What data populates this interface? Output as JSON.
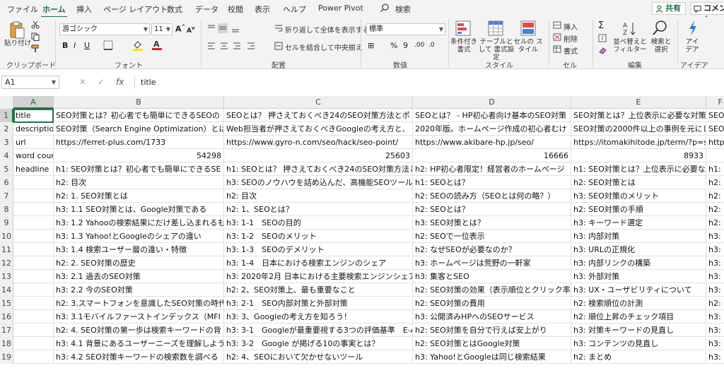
{
  "menu": {
    "tabs": [
      "ファイル",
      "ホーム",
      "挿入",
      "ページ レイアウト",
      "数式",
      "データ",
      "校閲",
      "表示",
      "ヘルプ",
      "Power Pivot"
    ],
    "active_tab": "ホーム",
    "search": "検索",
    "share": "共有",
    "comment": "コメント"
  },
  "ribbon": {
    "clipboard": {
      "paste": "貼り付け",
      "label": "クリップボード"
    },
    "font": {
      "name": "游ゴシック",
      "size": "11",
      "label": "フォント",
      "bold": "B",
      "italic": "I",
      "underline": "U"
    },
    "alignment": {
      "wrap": "折り返して全体を表示する",
      "merge": "セルを結合して中央揃え",
      "label": "配置"
    },
    "number": {
      "format": "標準",
      "label": "数値"
    },
    "styles": {
      "conditional": "条件付き 書式",
      "table": "テーブルとして 書式設定",
      "cell": "セルの スタイル",
      "label": "スタイル"
    },
    "cells": {
      "insert": "挿入",
      "delete": "削除",
      "format": "書式",
      "label": "セル"
    },
    "editing": {
      "sort": "並べ替えと フィルター",
      "find": "検索と 選択",
      "label": "編集"
    },
    "ideas": {
      "button": "アイ デア",
      "label": "アイデア"
    }
  },
  "formula_bar": {
    "name_box": "A1",
    "formula": "title"
  },
  "sheet": {
    "columns": [
      "A",
      "B",
      "C",
      "D",
      "E",
      "F"
    ],
    "selected_column": "A",
    "selected_row": "1",
    "rows": [
      {
        "num": "1",
        "cells": [
          "title",
          "SEO対策とは？初心者でも簡単にできるSEOの",
          "SEOとは？ 押さえておくべき24のSEO対策方法とポ",
          "SEOとは？ - HP初心者向け基本のSEO対策",
          "SEO対策とは？上位表示に必要な対策",
          "SEO"
        ]
      },
      {
        "num": "2",
        "cells": [
          "descriptio",
          "SEO対策（Search Engine Optimization）とは、",
          "Web担当者が押さえておくべきGoogleの考え方と、",
          "2020年版。ホームページ作成の初心者むけ",
          "SEO対策の2000件以上の事例を元にし",
          "SEO"
        ]
      },
      {
        "num": "3",
        "cells": [
          "url",
          "https://ferret-plus.com/1733",
          "https://www.gyro-n.com/seo/hack/seo-point/",
          "https://www.akibare-hp.jp/seo/",
          "https://itomakihitode.jp/term/?p=se",
          "http"
        ]
      },
      {
        "num": "4",
        "cells": [
          "word cour",
          "54298",
          "25603",
          "16666",
          "8933",
          ""
        ]
      },
      {
        "num": "5",
        "cells": [
          "headline",
          "h1: SEO対策とは？初心者でも簡単にできるSE",
          "h1: SEOとは？ 押さえておくべき24のSEO対策方法と",
          "h2: HP初心者限定！経営者のホームページ",
          "h1: SEO対策とは？上位表示に必要な",
          "h1: S"
        ]
      },
      {
        "num": "6",
        "cells": [
          "",
          "h2: 目次",
          "h3: SEOのノウハウを詰め込んだ、高機能SEOツール",
          "h1: SEOとは？",
          "h2: SEO対策とは",
          "h2:"
        ]
      },
      {
        "num": "7",
        "cells": [
          "",
          "h2: 1. SEO対策とは",
          "h2: 目次",
          "h2: SEOの読み方（SEOとは何の略？）",
          "h3: SEO対策のメリット",
          "h2:"
        ]
      },
      {
        "num": "8",
        "cells": [
          "",
          "h3: 1.1 SEO対策とは、Google対策である",
          "h2: 1、SEOとは？",
          "h2: SEOとは？",
          "h2: SEO対策の手順",
          "h2:"
        ]
      },
      {
        "num": "9",
        "cells": [
          "",
          "h3: 1.2 Yahooの検索結果にだけ差し込まれるも",
          "h3: 1-1　SEOの目的",
          "h3: SEO対策とは？",
          "h3: キーワード選定",
          "h2:"
        ]
      },
      {
        "num": "10",
        "cells": [
          "",
          "h3: 1.3 Yahoo!とGoogleのシェアの違い",
          "h3: 1-2　SEOのメリット",
          "h2: SEOで一位表示",
          "h3: 内部対策",
          "h3:"
        ]
      },
      {
        "num": "11",
        "cells": [
          "",
          "h3: 1.4 検索ユーザー層の違い・特徴",
          "h3: 1-3　SEOのデメリット",
          "h2: なぜSEOが必要なのか？",
          "h3: URLの正規化",
          "h3:"
        ]
      },
      {
        "num": "12",
        "cells": [
          "",
          "h2: 2. SEO対策の歴史",
          "h3: 1-4　日本における検索エンジンのシェア",
          "h3: ホームページは荒野の一軒家",
          "h3: 内部リンクの構築",
          "h3:"
        ]
      },
      {
        "num": "13",
        "cells": [
          "",
          "h3: 2.1 過去のSEO対策",
          "h3: 2020年2月 日本における主要検索エンジンシェア",
          "h3: 集客とSEO",
          "h3: 外部対策",
          "h3:"
        ]
      },
      {
        "num": "14",
        "cells": [
          "",
          "h3: 2.2 今のSEO対策",
          "h2: 2、SEO対策上、最も重要なこと",
          "h2: SEO対策の効果（表示順位とクリック率",
          "h3: UX・ユーザビリティについて",
          "h3:"
        ]
      },
      {
        "num": "15",
        "cells": [
          "",
          "h2: 3.スマートフォンを意識したSEO対策の時代",
          "h3: 2-1　SEO内部対策と外部対策",
          "h2: SEO対策の費用",
          "h2: 検索順位の計測",
          "h2:"
        ]
      },
      {
        "num": "16",
        "cells": [
          "",
          "h3: 3.1モバイルファーストインデックス（MFI",
          "h3: 3、Googleの考え方を知ろう！",
          "h3: 公開済みHPへのSEOサービス",
          "h2: 順位上昇のチェック項目",
          "h3:"
        ]
      },
      {
        "num": "17",
        "cells": [
          "",
          "h2: 4. SEO対策の第一歩は検索キーワードの背",
          "h3: 3-1　Googleが最重要視する3つの評価基準　E-A",
          "h2: SEO対策を自分で行えば安上がり",
          "h3: 対策キーワードの見直し",
          "h3:"
        ]
      },
      {
        "num": "18",
        "cells": [
          "",
          "h3: 4.1 背景にあるユーザーニーズを理解しよう",
          "h3: 3-2　Google が掲げる10の事実とは？",
          "h2: SEO対策とはGoogle対策",
          "h3: コンテンツの見直し",
          "h3:"
        ]
      },
      {
        "num": "19",
        "cells": [
          "",
          "h3: 4.2 SEO対策キーワードの検索数を調べる",
          "h2: 4、SEOにおいて欠かせないツール",
          "h3: Yahoo!とGoogleは同じ検索結果",
          "h2: まとめ",
          "h3:"
        ]
      }
    ]
  }
}
